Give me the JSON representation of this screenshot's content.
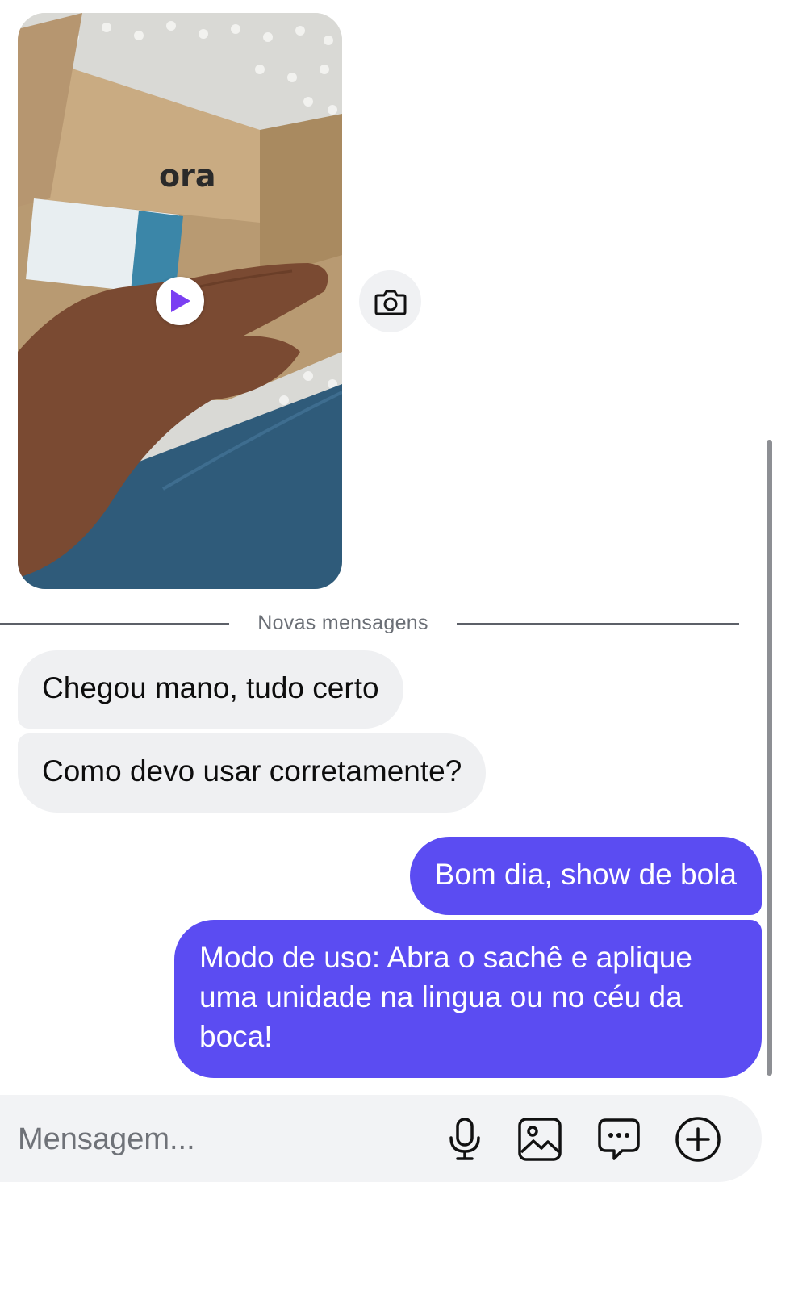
{
  "messages": {
    "video": {
      "thumbnail_icon": "play-icon",
      "box_print": "ora"
    },
    "divider_label": "Novas mensagens",
    "incoming": [
      {
        "text": "Chegou mano, tudo certo"
      },
      {
        "text": "Como devo usar corretamente?"
      }
    ],
    "outgoing": [
      {
        "text": "Bom dia, show de bola"
      },
      {
        "text": "Modo de uso: Abra o sachê e aplique uma unidade na lingua ou no céu da boca!"
      }
    ]
  },
  "composer": {
    "placeholder": "Mensagem...",
    "icons": [
      "microphone-icon",
      "image-icon",
      "sticker-icon",
      "plus-icon"
    ]
  },
  "colors": {
    "outgoing_bubble": "#5b4cf2",
    "incoming_bubble": "#eff0f2",
    "play_accent": "#7b3ff2"
  }
}
